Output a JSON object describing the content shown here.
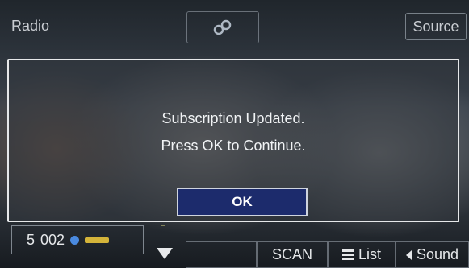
{
  "header": {
    "title": "Radio",
    "link_icon": "link-icon",
    "source_label": "Source"
  },
  "dialog": {
    "line1": "Subscription Updated.",
    "line2": "Press OK to Continue.",
    "ok_label": "OK"
  },
  "preset": {
    "number": "5",
    "channel": "002",
    "hd_icon": "hd-radio-icon",
    "badge_icon": "station-badge-icon"
  },
  "bottom_bar": {
    "scan_label": "SCAN",
    "list_label": "List",
    "list_icon": "list-icon",
    "sound_label": "Sound",
    "sound_icon": "left-arrow-icon"
  },
  "colors": {
    "dialog_border": "#e6e8ea",
    "ok_button_fill": "#1c2b6c",
    "text": "#f1f3f5"
  }
}
